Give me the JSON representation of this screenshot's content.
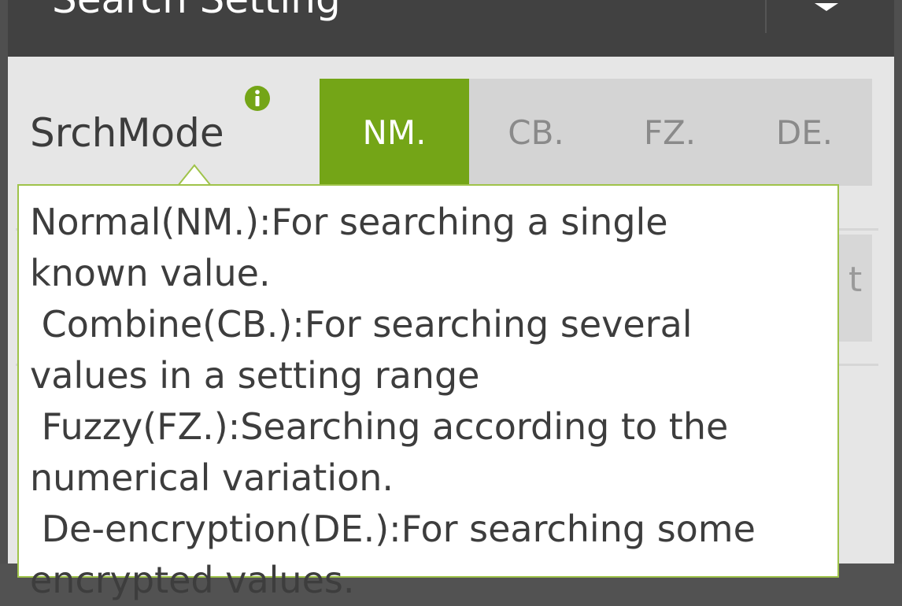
{
  "dialog": {
    "title": "Search Setting"
  },
  "search_mode": {
    "label": "SrchMode",
    "info_icon": "info-icon",
    "options": [
      {
        "label": "NM.",
        "selected": true
      },
      {
        "label": "CB.",
        "selected": false
      },
      {
        "label": "FZ.",
        "selected": false
      },
      {
        "label": "DE.",
        "selected": false
      }
    ]
  },
  "partial_field": {
    "text": "t"
  },
  "tooltip": {
    "lines": [
      "Normal(NM.):For searching a single",
      "known value.",
      " Combine(CB.):For searching several",
      "values in a setting range",
      " Fuzzy(FZ.):Searching according to the",
      "numerical variation.",
      " De-encryption(DE.):For searching some",
      "encrypted values."
    ]
  },
  "colors": {
    "accent": "#74a517",
    "titlebar": "#414141",
    "dialog_bg": "#e6e6e6"
  }
}
